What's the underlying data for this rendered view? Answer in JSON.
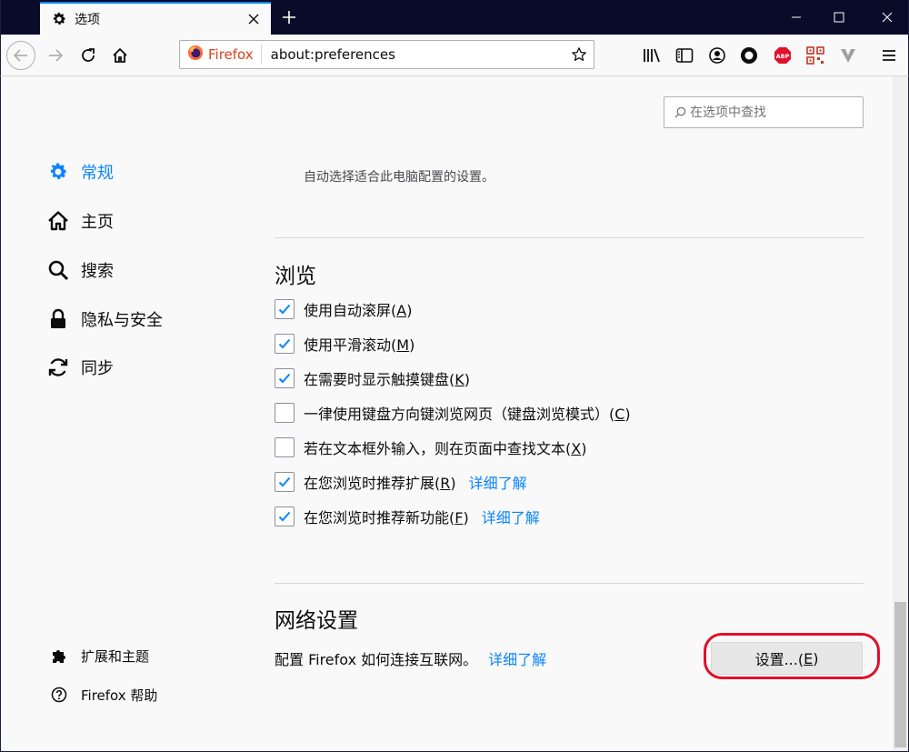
{
  "window": {
    "tab_title": "选项",
    "new_tab_symbol": "+"
  },
  "toolbar": {
    "identity_label": "Firefox",
    "url": "about:preferences"
  },
  "search": {
    "placeholder": "在选项中查找"
  },
  "sidebar": {
    "items": [
      {
        "label": "常规",
        "icon": "gear-icon",
        "selected": true
      },
      {
        "label": "主页",
        "icon": "home-icon"
      },
      {
        "label": "搜索",
        "icon": "search-icon"
      },
      {
        "label": "隐私与安全",
        "icon": "lock-icon"
      },
      {
        "label": "同步",
        "icon": "sync-icon"
      }
    ],
    "footer": [
      {
        "label": "扩展和主题",
        "icon": "puzzle-icon"
      },
      {
        "label": "Firefox 帮助",
        "icon": "help-icon"
      }
    ]
  },
  "general": {
    "performance_desc": "自动选择适合此电脑配置的设置。"
  },
  "browsing": {
    "title": "浏览",
    "options": [
      {
        "label_pre": "使用自动滚屏(",
        "key": "A",
        "label_post": ")",
        "checked": true,
        "link": ""
      },
      {
        "label_pre": "使用平滑滚动(",
        "key": "M",
        "label_post": ")",
        "checked": true,
        "link": ""
      },
      {
        "label_pre": "在需要时显示触摸键盘(",
        "key": "K",
        "label_post": ")",
        "checked": true,
        "link": ""
      },
      {
        "label_pre": "一律使用键盘方向键浏览网页（键盘浏览模式）(",
        "key": "C",
        "label_post": ")",
        "checked": false,
        "link": ""
      },
      {
        "label_pre": "若在文本框外输入，则在页面中查找文本(",
        "key": "X",
        "label_post": ")",
        "checked": false,
        "link": ""
      },
      {
        "label_pre": "在您浏览时推荐扩展(",
        "key": "R",
        "label_post": ")",
        "checked": true,
        "link": "详细了解"
      },
      {
        "label_pre": "在您浏览时推荐新功能(",
        "key": "F",
        "label_post": ")",
        "checked": true,
        "link": "详细了解"
      }
    ]
  },
  "network": {
    "title": "网络设置",
    "desc": "配置 Firefox 如何连接互联网。",
    "link": "详细了解",
    "button_pre": "设置...(",
    "button_key": "E",
    "button_post": ")"
  },
  "colors": {
    "accent": "#0a84ff",
    "highlight_ring": "#e0102a",
    "titlebar": "#0a0a29"
  }
}
